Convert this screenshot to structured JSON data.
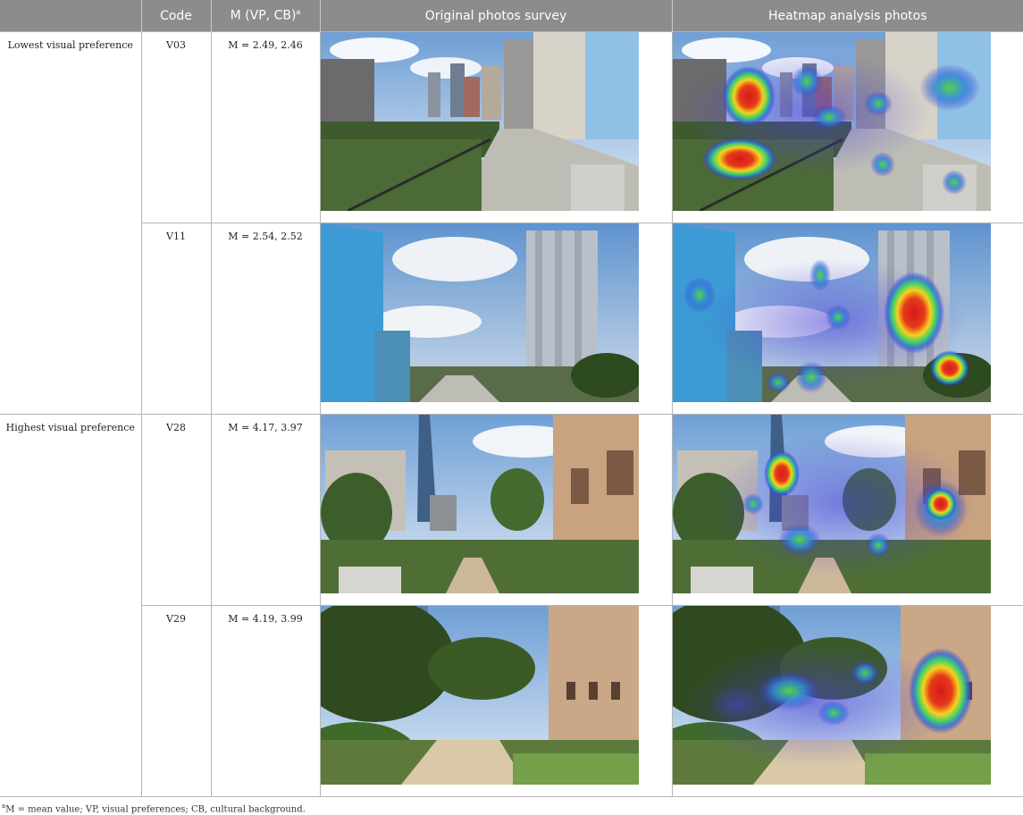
{
  "table": {
    "headers": {
      "code": "Code",
      "m": "M (VP, CB)",
      "m_sup": "a",
      "original": "Original photos survey",
      "heatmap": "Heatmap analysis photos"
    },
    "groups": [
      {
        "label": "Lowest visual preference",
        "rows": [
          {
            "code": "V03",
            "m": "M = 2.49, 2.46"
          },
          {
            "code": "V11",
            "m": "M = 2.54, 2.52"
          }
        ]
      },
      {
        "label": "Highest visual preference",
        "rows": [
          {
            "code": "V28",
            "m": "M = 4.17, 3.97"
          },
          {
            "code": "V29",
            "m": "M = 4.19, 3.99"
          }
        ]
      }
    ]
  },
  "footnote": {
    "sup": "a",
    "text": "M = mean value; VP, visual preferences; CB, cultural background."
  }
}
